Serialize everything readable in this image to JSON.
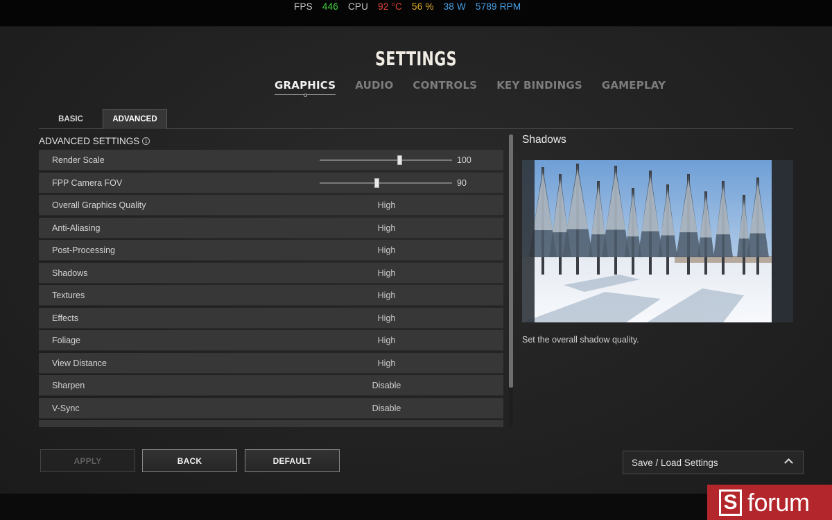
{
  "hud": {
    "fps_label": "FPS",
    "fps_value": "446",
    "cpu_label": "CPU",
    "cpu_temp": "92 °C",
    "cpu_load": "56 %",
    "cpu_power": "38 W",
    "fan_rpm": "5789 RPM",
    "colors": {
      "fps": "#3fd53f",
      "temp": "#e4473c",
      "load": "#e7b52c",
      "power": "#4aa3e8",
      "rpm": "#4aa3e8"
    }
  },
  "title": "SETTINGS",
  "top_tabs": [
    {
      "label": "GRAPHICS",
      "active": true
    },
    {
      "label": "AUDIO",
      "active": false
    },
    {
      "label": "CONTROLS",
      "active": false
    },
    {
      "label": "KEY BINDINGS",
      "active": false
    },
    {
      "label": "GAMEPLAY",
      "active": false
    }
  ],
  "sub_tabs": {
    "basic": "BASIC",
    "advanced": "ADVANCED"
  },
  "advanced_heading": "ADVANCED SETTINGS",
  "settings": [
    {
      "label": "Render Scale",
      "type": "slider",
      "value": "100",
      "level": 0.6
    },
    {
      "label": "FPP Camera FOV",
      "type": "slider",
      "value": "90",
      "level": 0.43
    },
    {
      "label": "Overall Graphics Quality",
      "value": "High"
    },
    {
      "label": "Anti-Aliasing",
      "value": "High"
    },
    {
      "label": "Post-Processing",
      "value": "High"
    },
    {
      "label": "Shadows",
      "value": "High"
    },
    {
      "label": "Textures",
      "value": "High"
    },
    {
      "label": "Effects",
      "value": "High"
    },
    {
      "label": "Foliage",
      "value": "High"
    },
    {
      "label": "View Distance",
      "value": "High"
    },
    {
      "label": "Sharpen",
      "value": "Disable"
    },
    {
      "label": "V-Sync",
      "value": "Disable"
    },
    {
      "label": "",
      "value": ""
    }
  ],
  "preview": {
    "title": "Shadows",
    "description": "Set the overall shadow quality."
  },
  "buttons": {
    "apply": "APPLY",
    "back": "BACK",
    "default": "DEFAULT"
  },
  "save_load": "Save / Load Settings",
  "badge": {
    "text": "forum",
    "logo_letter": "S",
    "color": "#b3262b"
  }
}
